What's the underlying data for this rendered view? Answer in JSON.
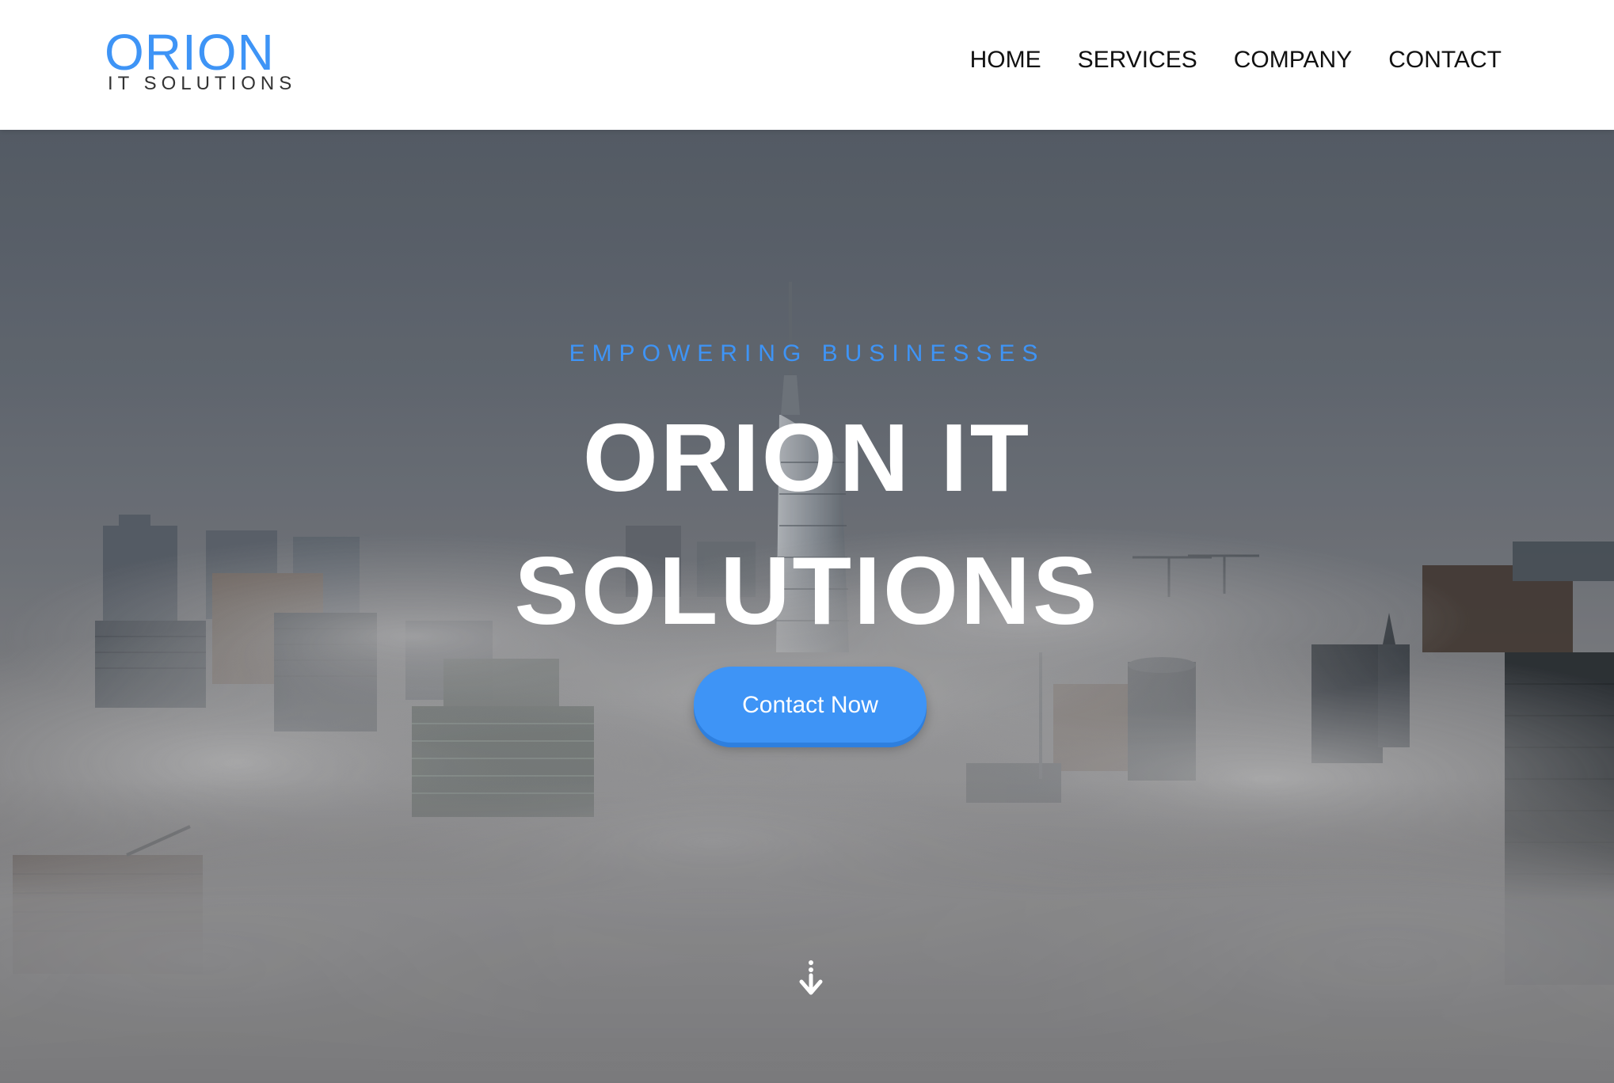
{
  "header": {
    "logo": {
      "main": "ORION",
      "sub": "IT SOLUTIONS"
    },
    "nav": [
      {
        "label": "HOME"
      },
      {
        "label": "SERVICES"
      },
      {
        "label": "COMPANY"
      },
      {
        "label": "CONTACT"
      }
    ]
  },
  "hero": {
    "tagline": "EMPOWERING BUSINESSES",
    "title_line1": "ORION IT",
    "title_line2": "SOLUTIONS",
    "cta_label": "Contact Now",
    "scroll_icon": "scroll-down-arrow-icon",
    "background_description": "city-buildings-in-fog"
  },
  "colors": {
    "accent": "#3e94f6",
    "header_bg": "#ffffff",
    "nav_text": "#111111",
    "hero_text": "#ffffff"
  }
}
